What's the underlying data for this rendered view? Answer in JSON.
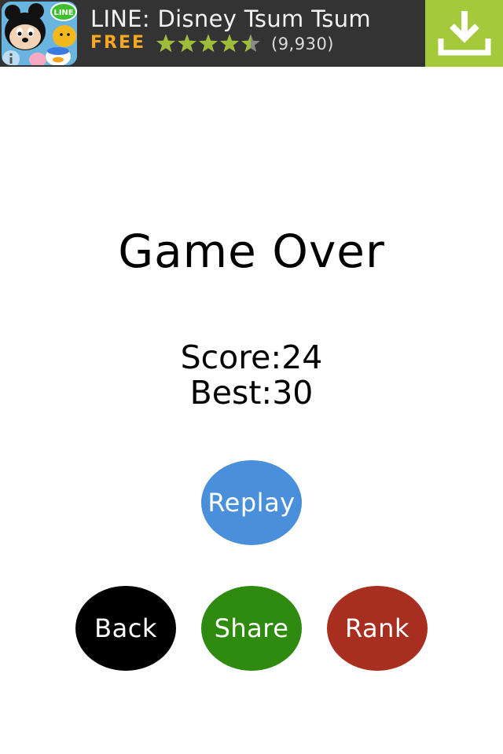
{
  "ad": {
    "title": "LINE: Disney Tsum Tsum",
    "price": "FREE",
    "rating": 4.5,
    "rating_max": 5,
    "review_count": "(9,930)",
    "app_icon": "tsum-tsum-app-icon",
    "badge_text": "LINE",
    "install_icon": "download-icon",
    "colors": {
      "banner_bg": "#333333",
      "price": "#f5a623",
      "stars": "#9dbd3a",
      "install_bg": "#a4c93a"
    }
  },
  "game": {
    "title": "Game Over",
    "score_text": "Score:24",
    "best_text": "Best:30",
    "score": 24,
    "best": 30
  },
  "buttons": {
    "replay": "Replay",
    "back": "Back",
    "share": "Share",
    "rank": "Rank"
  },
  "colors": {
    "replay": "#4a8fd9",
    "back": "#000000",
    "share": "#2e8b0f",
    "rank": "#a82f20"
  }
}
